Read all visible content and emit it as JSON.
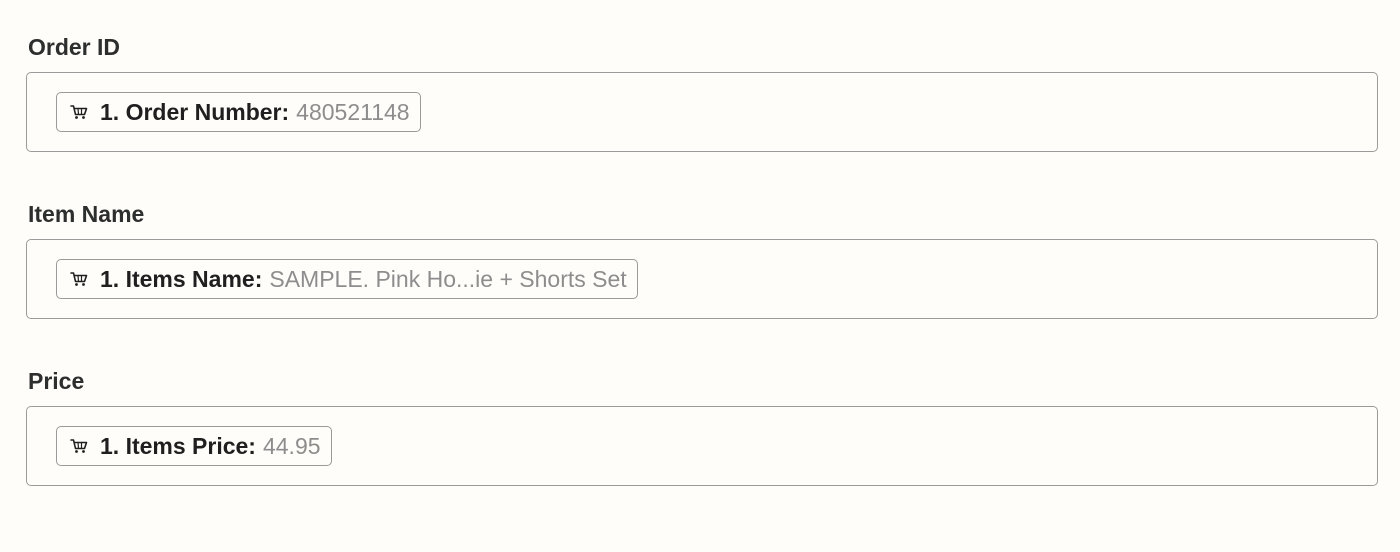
{
  "fields": [
    {
      "label": "Order ID",
      "pill": {
        "icon": "shopping-cart-icon",
        "key": "1. Order Number:",
        "value": "480521148"
      }
    },
    {
      "label": "Item Name",
      "pill": {
        "icon": "shopping-cart-icon",
        "key": "1. Items Name:",
        "value": "SAMPLE. Pink Ho...ie + Shorts Set"
      }
    },
    {
      "label": "Price",
      "pill": {
        "icon": "shopping-cart-icon",
        "key": "1. Items Price:",
        "value": "44.95"
      }
    }
  ]
}
